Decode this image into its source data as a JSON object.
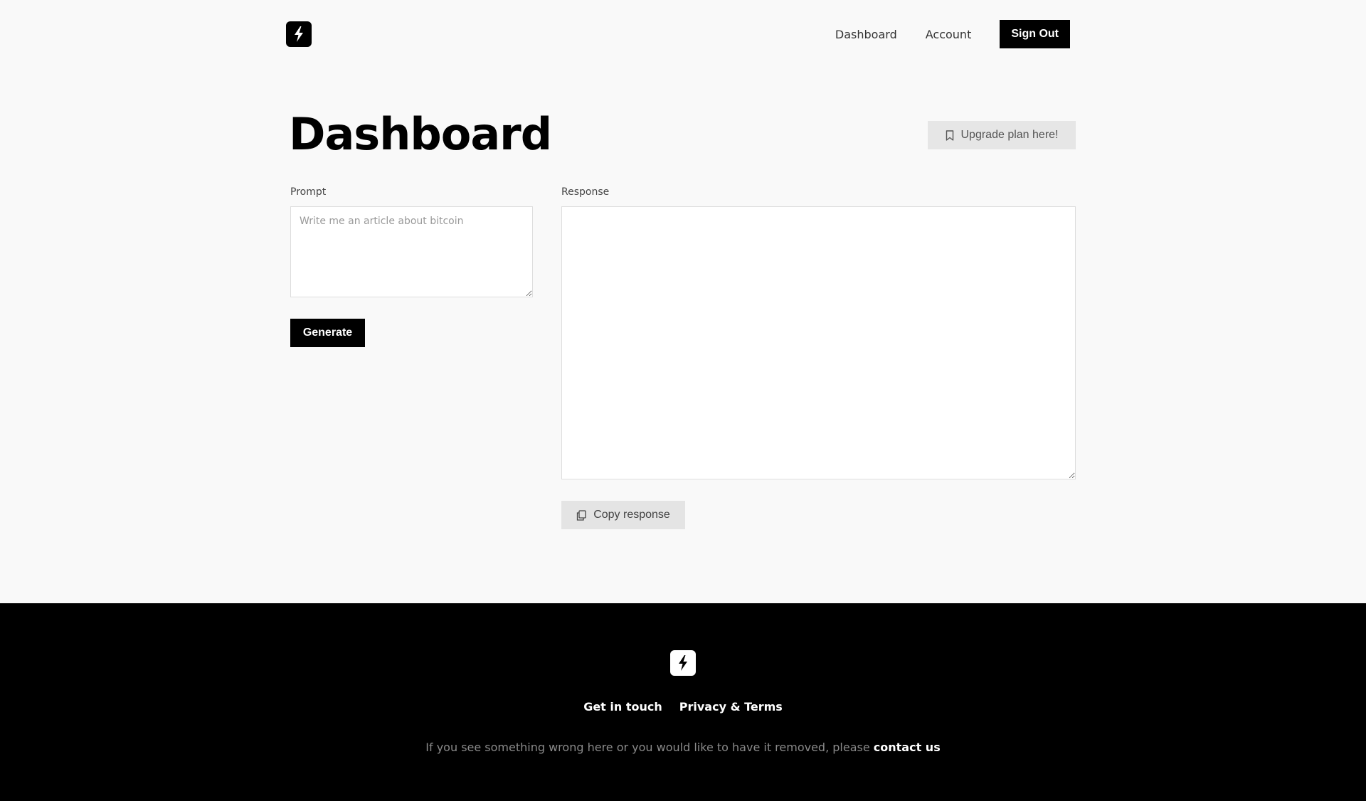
{
  "header": {
    "logo_icon": "lightning-bolt-icon",
    "nav": {
      "dashboard_label": "Dashboard",
      "account_label": "Account",
      "signout_label": "Sign Out"
    }
  },
  "main": {
    "title": "Dashboard",
    "upgrade_label": "Upgrade plan here!",
    "prompt": {
      "label": "Prompt",
      "placeholder": "Write me an article about bitcoin",
      "value": ""
    },
    "generate_label": "Generate",
    "response": {
      "label": "Response",
      "value": ""
    },
    "copy_label": "Copy response"
  },
  "footer": {
    "logo_icon": "lightning-bolt-icon",
    "links": {
      "get_in_touch": "Get in touch",
      "privacy_terms": "Privacy & Terms"
    },
    "note_text": "If you see something wrong here or you would like to have it removed, please ",
    "note_link": "contact us"
  },
  "colors": {
    "background": "#f9f9f9",
    "primary": "#000000",
    "secondary_button": "#e6e6e6",
    "footer_background": "#000000"
  }
}
